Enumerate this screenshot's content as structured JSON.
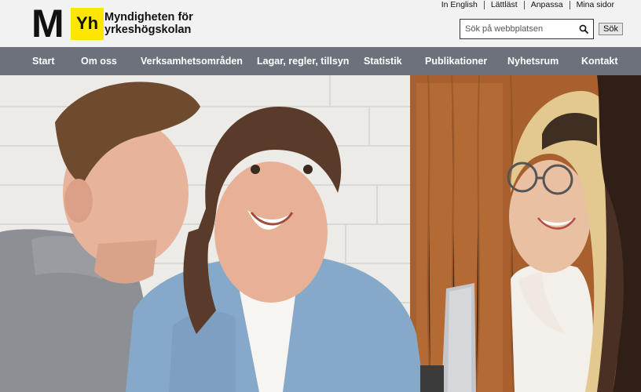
{
  "logo": {
    "letter_m": "M",
    "letter_yh": "Yh",
    "name_line1": "Myndigheten för",
    "name_line2": "yrkeshögskolan"
  },
  "top_links": [
    "In English",
    "Lättläst",
    "Anpassa",
    "Mina sidor"
  ],
  "search": {
    "placeholder": "Sök på webbplatsen",
    "button_label": "Sök"
  },
  "nav": [
    "Start",
    "Om oss",
    "Verksamhetsområden",
    "Lagar, regler, tillsyn",
    "Statistik",
    "Publikationer",
    "Nyhetsrum",
    "Kontakt"
  ],
  "colors": {
    "header_bg": "#f2f2f2",
    "nav_bg": "#6c717b",
    "logo_yellow": "#ffe600"
  },
  "hero": {
    "icon": "hero-photo-students"
  }
}
